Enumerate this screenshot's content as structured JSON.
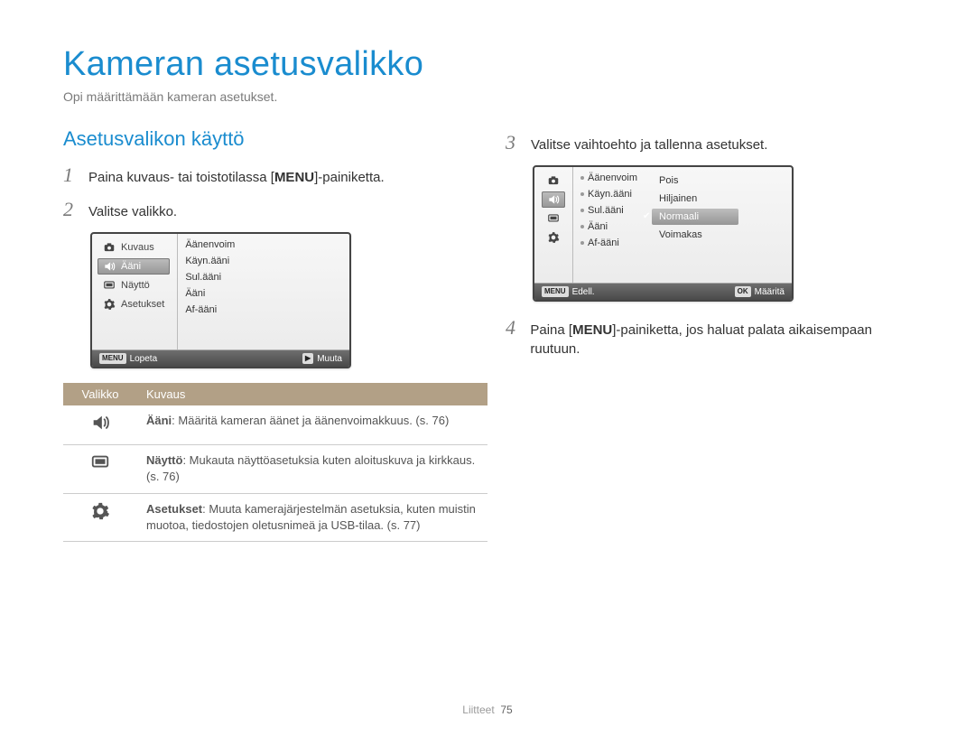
{
  "title": "Kameran asetusvalikko",
  "intro": "Opi määrittämään kameran asetukset.",
  "section_heading": "Asetusvalikon käyttö",
  "steps": {
    "s1": {
      "num": "1",
      "pre": "Paina kuvaus- tai toistotilassa [",
      "key": "MENU",
      "post": "]-painiketta."
    },
    "s2": {
      "num": "2",
      "text": "Valitse valikko."
    },
    "s3": {
      "num": "3",
      "text": "Valitse vaihtoehto ja tallenna asetukset."
    },
    "s4": {
      "num": "4",
      "pre": "Paina [",
      "key": "MENU",
      "post": "]-painiketta, jos haluat palata aikaisempaan ruutuun."
    }
  },
  "lcd1": {
    "left": [
      {
        "icon": "camera",
        "label": "Kuvaus",
        "selected": false
      },
      {
        "icon": "sound",
        "label": "Ääni",
        "selected": true
      },
      {
        "icon": "display",
        "label": "Näyttö",
        "selected": false
      },
      {
        "icon": "gear",
        "label": "Asetukset",
        "selected": false
      }
    ],
    "right": [
      "Äänenvoim",
      "Käyn.ääni",
      "Sul.ääni",
      "Ääni",
      "Af-ääni"
    ],
    "footer": {
      "left_chip": "MENU",
      "left_text": "Lopeta",
      "right_chip": "▶",
      "right_text": "Muuta"
    }
  },
  "lcd2": {
    "side_icons": [
      "camera",
      "sound",
      "display",
      "gear"
    ],
    "side_selected": "sound",
    "items": [
      "Äänenvoim",
      "Käyn.ääni",
      "Sul.ääni",
      "Ääni",
      "Af-ääni"
    ],
    "options": [
      "Pois",
      "Hiljainen",
      "Normaali",
      "Voimakas"
    ],
    "selected_option": "Normaali",
    "footer": {
      "left_chip": "MENU",
      "left_text": "Edell.",
      "right_chip": "OK",
      "right_text": "Määritä"
    }
  },
  "table": {
    "head": {
      "c1": "Valikko",
      "c2": "Kuvaus"
    },
    "rows": [
      {
        "icon": "sound",
        "title": "Ääni",
        "text": ": Määritä kameran äänet ja äänenvoimakkuus. (s. 76)"
      },
      {
        "icon": "display",
        "title": "Näyttö",
        "text": ": Mukauta näyttöasetuksia kuten aloituskuva ja kirkkaus. (s. 76)"
      },
      {
        "icon": "gear",
        "title": "Asetukset",
        "text": ": Muuta kamerajärjestelmän asetuksia, kuten muistin muotoa, tiedostojen oletusnimeä ja USB-tilaa. (s. 77)"
      }
    ]
  },
  "footer": {
    "label": "Liitteet",
    "page": "75"
  }
}
